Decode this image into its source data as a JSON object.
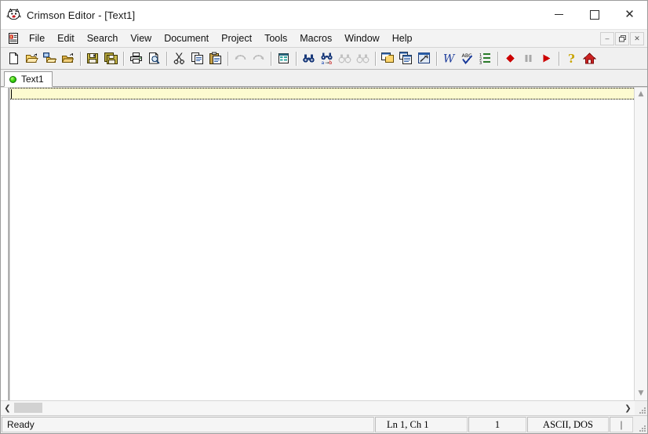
{
  "window": {
    "title": "Crimson Editor - [Text1]",
    "app_icon": "crimson-editor-icon",
    "controls": {
      "minimize": "minimize",
      "maximize": "maximize",
      "close": "close"
    }
  },
  "menubar": {
    "document_icon": "document-icon",
    "items": [
      {
        "label": "File"
      },
      {
        "label": "Edit"
      },
      {
        "label": "Search"
      },
      {
        "label": "View"
      },
      {
        "label": "Document"
      },
      {
        "label": "Project"
      },
      {
        "label": "Tools"
      },
      {
        "label": "Macros"
      },
      {
        "label": "Window"
      },
      {
        "label": "Help"
      }
    ],
    "mdi_controls": {
      "minimize": "–",
      "restore": "❐",
      "close": "✕"
    }
  },
  "toolbar": {
    "groups": [
      {
        "buttons": [
          {
            "icon": "new-file-icon",
            "title": "New"
          },
          {
            "icon": "open-folder-icon",
            "title": "Open"
          },
          {
            "icon": "open-remote-icon",
            "title": "Open Remote"
          },
          {
            "icon": "close-folder-icon",
            "title": "Close"
          }
        ]
      },
      {
        "buttons": [
          {
            "icon": "save-icon",
            "title": "Save"
          },
          {
            "icon": "save-all-icon",
            "title": "Save All"
          }
        ]
      },
      {
        "buttons": [
          {
            "icon": "print-icon",
            "title": "Print"
          },
          {
            "icon": "print-preview-icon",
            "title": "Print Preview"
          }
        ]
      },
      {
        "buttons": [
          {
            "icon": "cut-scissors-icon",
            "title": "Cut"
          },
          {
            "icon": "copy-icon",
            "title": "Copy"
          },
          {
            "icon": "paste-clipboard-icon",
            "title": "Paste"
          }
        ]
      },
      {
        "buttons": [
          {
            "icon": "undo-arrow-icon",
            "title": "Undo"
          },
          {
            "icon": "redo-arrow-icon",
            "title": "Redo"
          }
        ]
      },
      {
        "buttons": [
          {
            "icon": "column-mode-icon",
            "title": "Column Mode"
          }
        ]
      },
      {
        "buttons": [
          {
            "icon": "find-binoculars-icon",
            "title": "Find"
          },
          {
            "icon": "replace-binoculars-icon",
            "title": "Replace"
          },
          {
            "icon": "find-previous-icon",
            "title": "Find Previous"
          },
          {
            "icon": "find-next-icon",
            "title": "Find Next"
          }
        ]
      },
      {
        "buttons": [
          {
            "icon": "window-tile-icon",
            "title": "Tile Windows"
          },
          {
            "icon": "window-cascade-icon",
            "title": "Cascade Windows"
          },
          {
            "icon": "user-tools-icon",
            "title": "User Tools"
          }
        ]
      },
      {
        "buttons": [
          {
            "icon": "word-wrap-icon",
            "title": "Word Wrap"
          },
          {
            "icon": "spell-check-icon",
            "title": "Spell Check"
          },
          {
            "icon": "line-numbers-icon",
            "title": "Line Numbers"
          }
        ]
      },
      {
        "buttons": [
          {
            "icon": "record-macro-icon",
            "title": "Record Macro"
          },
          {
            "icon": "pause-macro-icon",
            "title": "Pause Macro"
          },
          {
            "icon": "play-macro-icon",
            "title": "Play Macro"
          }
        ]
      },
      {
        "buttons": [
          {
            "icon": "help-question-icon",
            "title": "Help"
          },
          {
            "icon": "home-house-icon",
            "title": "Home"
          }
        ]
      }
    ]
  },
  "tabstrip": {
    "tabs": [
      {
        "label": "Text1",
        "status_icon": "green-dot-icon",
        "active": true
      }
    ]
  },
  "editor": {
    "content": "",
    "current_line_highlight": "#fdfbd0",
    "background": "#ffffff"
  },
  "scrollbars": {
    "vertical": {
      "up_arrow": "▲",
      "down_arrow": "▼"
    },
    "horizontal": {
      "left_arrow": "❮",
      "right_arrow": "❯"
    }
  },
  "statusbar": {
    "message": "Ready",
    "position": "Ln 1,  Ch 1",
    "column": "1",
    "encoding": "ASCII, DOS",
    "insert_mode": "|"
  },
  "colors": {
    "window_background": "#f0f0f0",
    "titlebar": "#ffffff",
    "editor_background": "#ffffff",
    "current_line": "#fdfbd0",
    "tab_active": "#ffffff",
    "accent_red": "#cc0000",
    "accent_green": "#2ec40a"
  }
}
